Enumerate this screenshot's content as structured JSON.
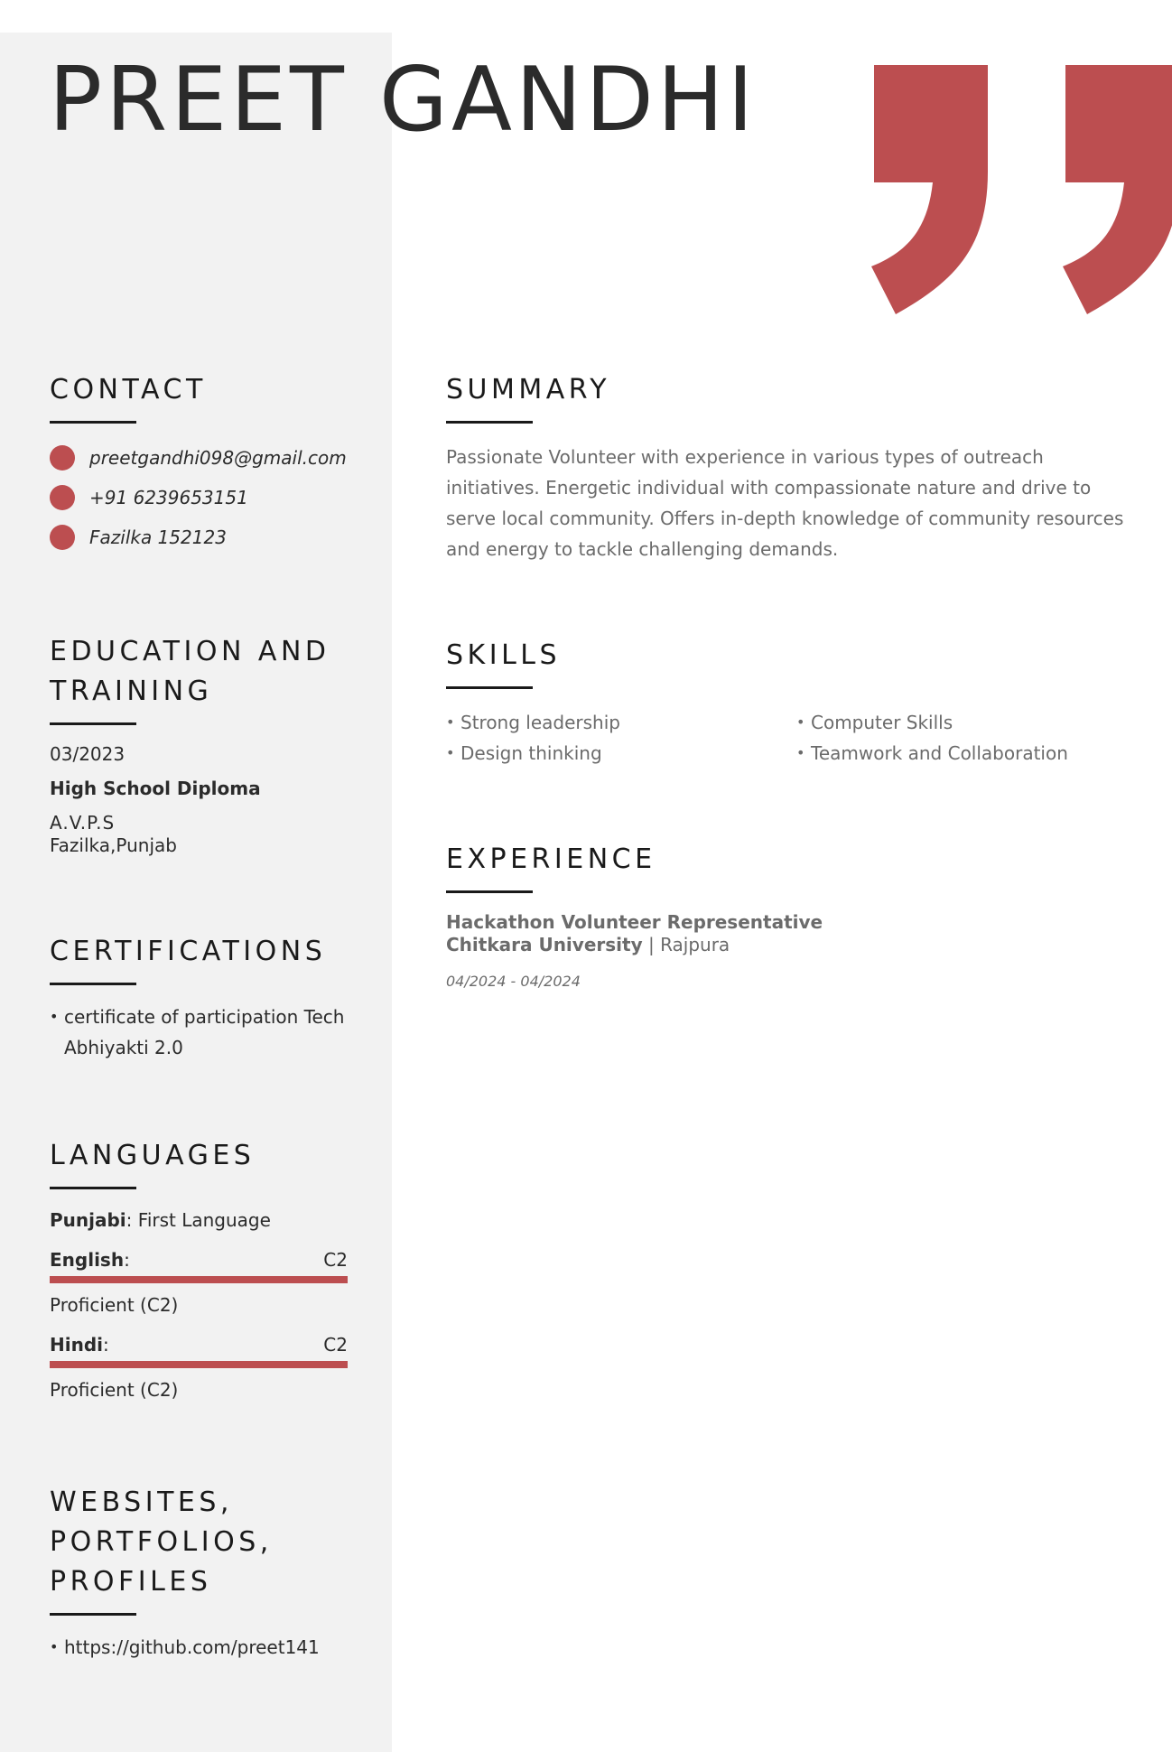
{
  "name": "PREET GANDHI",
  "colors": {
    "accent": "#bc4e50",
    "sidebar": "#f2f2f2",
    "heading": "#1a1a1a",
    "muted": "#6b6b6b"
  },
  "decoration_icon": "closing-quote-icon",
  "contact": {
    "heading": "CONTACT",
    "items": [
      {
        "icon": "dot-icon",
        "text": "preetgandhi098@gmail.com"
      },
      {
        "icon": "dot-icon",
        "text": "+91 6239653151"
      },
      {
        "icon": "dot-icon",
        "text": "Fazilka 152123"
      }
    ]
  },
  "education": {
    "heading_line1": "EDUCATION AND",
    "heading_line2": "TRAINING",
    "date": "03/2023",
    "degree": "High School Diploma",
    "school": "A.V.P.S",
    "place": "Fazilka,Punjab"
  },
  "certifications": {
    "heading": "CERTIFICATIONS",
    "items": [
      "certificate of participation Tech Abhiyakti 2.0"
    ]
  },
  "languages": {
    "heading": "LANGUAGES",
    "native": {
      "name": "Punjabi",
      "sep": ":",
      "desc": "First Language"
    },
    "items": [
      {
        "name": "English",
        "sep": ":",
        "code": "C2",
        "level": "Proficient (C2)",
        "fill_fraction": 1.0
      },
      {
        "name": "Hindi",
        "sep": ":",
        "code": "C2",
        "level": "Proficient (C2)",
        "fill_fraction": 1.0
      }
    ]
  },
  "websites": {
    "heading_line1": "WEBSITES,",
    "heading_line2": "PORTFOLIOS,",
    "heading_line3": "PROFILES",
    "items": [
      "https://github.com/preet141"
    ]
  },
  "summary": {
    "heading": "SUMMARY",
    "text": "Passionate Volunteer with experience in various types of outreach initiatives. Energetic individual with compassionate nature and drive to serve local community. Offers in-depth knowledge of community resources and energy to tackle challenging demands."
  },
  "skills": {
    "heading": "SKILLS",
    "items": [
      "Strong leadership",
      "Computer Skills",
      "Design thinking",
      "Teamwork and Collaboration"
    ]
  },
  "experience": {
    "heading": "EXPERIENCE",
    "title": "Hackathon Volunteer Representative",
    "company": "Chitkara University",
    "separator": " | ",
    "location": "Rajpura",
    "dates": "04/2024 - 04/2024"
  }
}
